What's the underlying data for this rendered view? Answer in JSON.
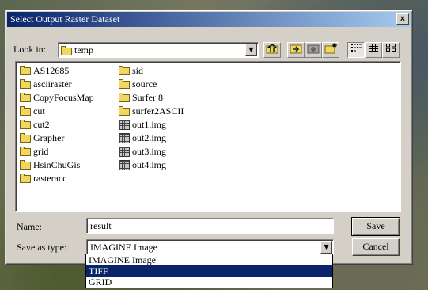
{
  "dialog": {
    "title": "Select Output Raster Dataset"
  },
  "look_in": {
    "label": "Look in:",
    "value": "temp"
  },
  "toolbar": {
    "buttons": [
      {
        "name": "up-one-level",
        "icon": "folder-up-icon"
      },
      {
        "name": "connect-folder",
        "icon": "connect-folder-icon"
      },
      {
        "name": "disconnect-folder",
        "icon": "disconnect-folder-icon"
      },
      {
        "name": "new-folder",
        "icon": "new-folder-icon"
      },
      {
        "name": "list-view",
        "icon": "list-view-icon"
      },
      {
        "name": "details-view",
        "icon": "details-view-icon"
      },
      {
        "name": "thumbnails-view",
        "icon": "thumbnails-view-icon"
      }
    ]
  },
  "files": {
    "col1": [
      "AS12685",
      "asciiraster",
      "CopyFocusMap",
      "cut",
      "cut2",
      "Grapher",
      "grid",
      "HsinChuGis",
      "rasteracc"
    ],
    "col2": [
      {
        "name": "sid",
        "type": "folder"
      },
      {
        "name": "source",
        "type": "folder"
      },
      {
        "name": "Surfer 8",
        "type": "folder"
      },
      {
        "name": "surfer2ASCII",
        "type": "folder"
      },
      {
        "name": "out1.img",
        "type": "raster"
      },
      {
        "name": "out2.img",
        "type": "raster"
      },
      {
        "name": "out3.img",
        "type": "raster"
      },
      {
        "name": "out4.img",
        "type": "raster"
      }
    ]
  },
  "name_field": {
    "label": "Name:",
    "value": "result"
  },
  "save_as_type": {
    "label": "Save as type:",
    "value": "IMAGINE Image",
    "options": [
      "IMAGINE Image",
      "TIFF",
      "GRID"
    ],
    "selected_option": "TIFF"
  },
  "buttons": {
    "save": "Save",
    "cancel": "Cancel",
    "close": "×"
  }
}
